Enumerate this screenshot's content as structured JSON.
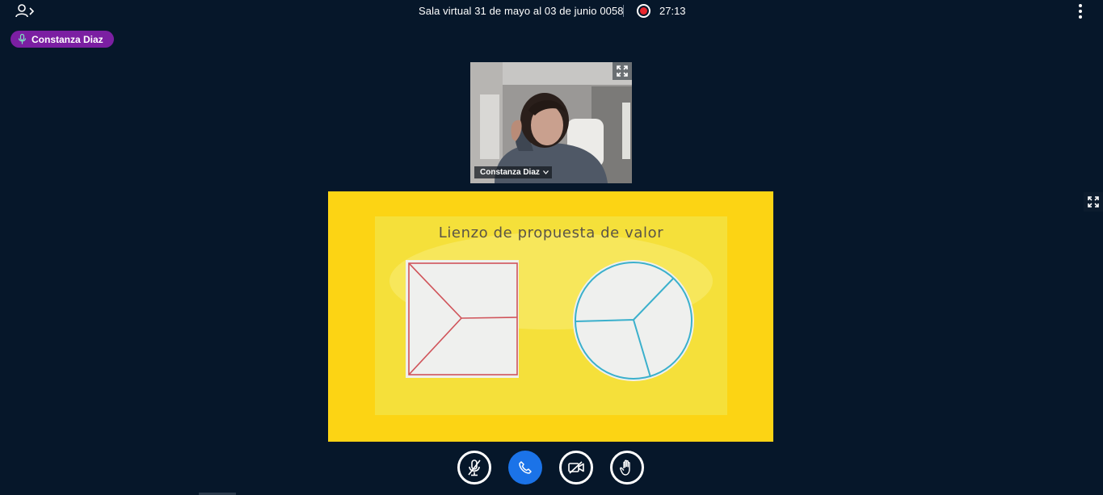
{
  "header": {
    "meeting_title": "Sala virtual 31 de mayo al 03 de junio 0058",
    "recording_time": "27:13",
    "icons": {
      "users": "user-list-toggle-icon",
      "record": "record-indicator-icon",
      "options": "vertical-dots-icon"
    }
  },
  "talking_indicator": {
    "name": "Constanza Diaz",
    "icon": "microphone-icon",
    "color": "#7b1fa2"
  },
  "webcam": {
    "user_name": "Constanza Diaz",
    "icons": {
      "expand": "fullscreen-expand-icon",
      "dropdown": "chevron-down-icon"
    }
  },
  "presentation": {
    "slide_title": "Lienzo de propuesta de valor",
    "background_color": "#fcd414",
    "icons": {
      "fullscreen": "fullscreen-expand-icon"
    }
  },
  "action_bar": {
    "buttons": [
      {
        "name": "mute-audio-button",
        "icon": "microphone-slash-icon",
        "style": "outline"
      },
      {
        "name": "leave-audio-button",
        "icon": "phone-icon",
        "style": "filled",
        "color": "#1b73e8"
      },
      {
        "name": "share-webcam-button",
        "icon": "camera-slash-icon",
        "style": "outline"
      },
      {
        "name": "raise-hand-button",
        "icon": "hand-icon",
        "style": "outline"
      }
    ]
  }
}
